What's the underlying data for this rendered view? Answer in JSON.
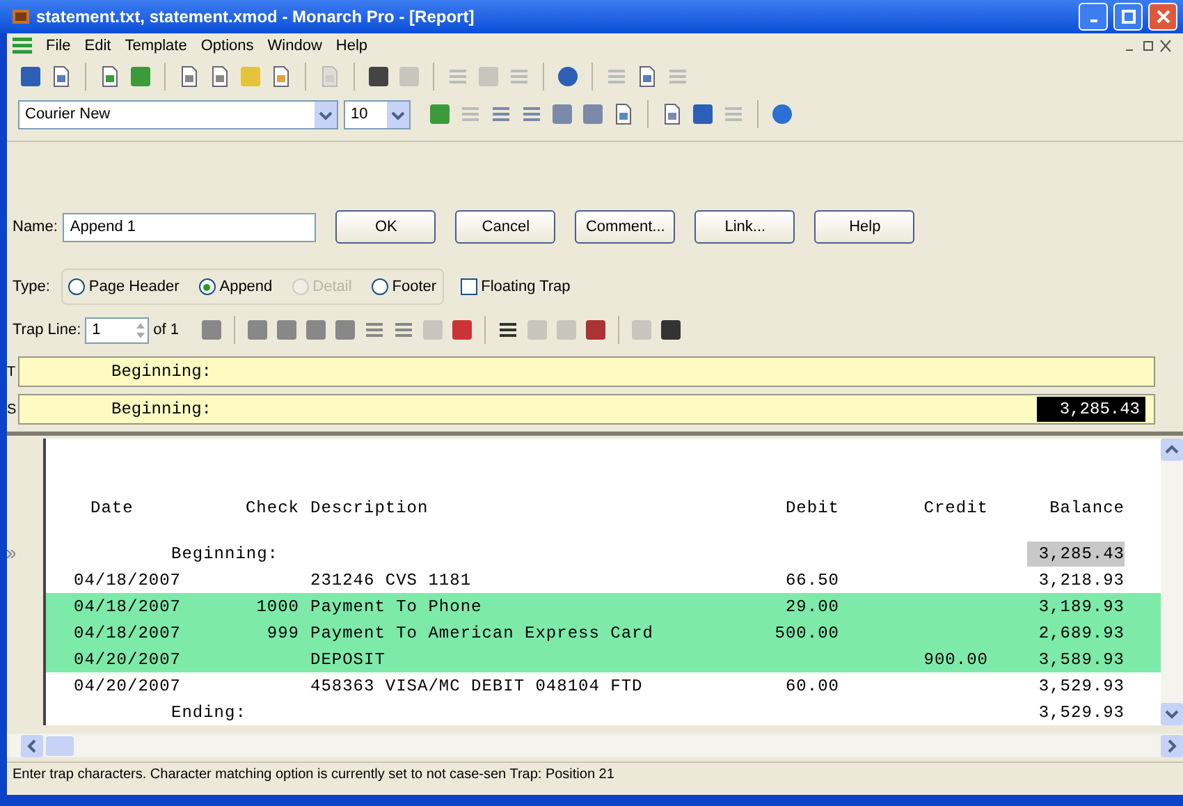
{
  "window": {
    "title": "statement.txt, statement.xmod - Monarch Pro - [Report]"
  },
  "menu": [
    "File",
    "Edit",
    "Template",
    "Options",
    "Window",
    "Help"
  ],
  "font_toolbar": {
    "font": "Courier New",
    "size": "10"
  },
  "trap_form": {
    "name_label": "Name:",
    "name_value": "Append 1",
    "buttons": [
      "OK",
      "Cancel",
      "Comment...",
      "Link...",
      "Help"
    ],
    "type_label": "Type:",
    "types": [
      {
        "label": "Page Header",
        "selected": false,
        "disabled": false
      },
      {
        "label": "Append",
        "selected": true,
        "disabled": false
      },
      {
        "label": "Detail",
        "selected": false,
        "disabled": true
      },
      {
        "label": "Footer",
        "selected": false,
        "disabled": false
      }
    ],
    "floating_trap": {
      "label": "Floating Trap",
      "checked": false
    },
    "trap_line_label": "Trap Line:",
    "trap_line_value": "1",
    "trap_line_of": "of 1"
  },
  "trap_lines": [
    {
      "marker": "T",
      "text": "Beginning:"
    },
    {
      "marker": "S",
      "text": "Beginning:",
      "selection": "3,285.43"
    }
  ],
  "report": {
    "columns": [
      "Date",
      "Check",
      "Description",
      "Debit",
      "Credit",
      "Balance"
    ],
    "rows": [
      {
        "kind": "label",
        "label": "Beginning:",
        "balance": "3,285.43",
        "current": true,
        "highlighted": false
      },
      {
        "kind": "entry",
        "cells": [
          "04/18/2007",
          "",
          "231246 CVS 1181",
          "66.50",
          "",
          "3,218.93"
        ],
        "highlighted": false
      },
      {
        "kind": "entry",
        "cells": [
          "04/18/2007",
          "1000",
          "Payment To Phone",
          "29.00",
          "",
          "3,189.93"
        ],
        "highlighted": true
      },
      {
        "kind": "entry",
        "cells": [
          "04/18/2007",
          "999",
          "Payment To American Express Card",
          "500.00",
          "",
          "2,689.93"
        ],
        "highlighted": true
      },
      {
        "kind": "entry",
        "cells": [
          "04/20/2007",
          "",
          "DEPOSIT",
          "",
          "900.00",
          "3,589.93"
        ],
        "highlighted": true
      },
      {
        "kind": "entry",
        "cells": [
          "04/20/2007",
          "",
          "458363 VISA/MC DEBIT 048104 FTD",
          "60.00",
          "",
          "3,529.93"
        ],
        "highlighted": false
      },
      {
        "kind": "label",
        "label": "Ending:",
        "balance": "3,529.93",
        "current": false,
        "highlighted": false
      }
    ]
  },
  "status_bar": "Enter trap characters. Character matching option is currently set to not case-sen Trap: Position 21"
}
